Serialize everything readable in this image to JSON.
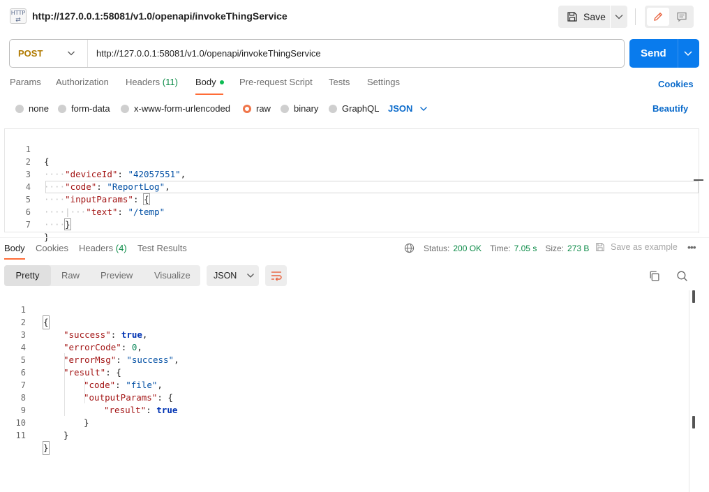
{
  "header": {
    "icon_label": "HTTP",
    "title": "http://127.0.0.1:58081/v1.0/openapi/invokeThingService",
    "save_label": "Save"
  },
  "request": {
    "method": "POST",
    "url": "http://127.0.0.1:58081/v1.0/openapi/invokeThingService",
    "send_label": "Send",
    "tabs": [
      {
        "label": "Params"
      },
      {
        "label": "Authorization"
      },
      {
        "label": "Headers",
        "count": "(11)"
      },
      {
        "label": "Body"
      },
      {
        "label": "Pre-request Script"
      },
      {
        "label": "Tests"
      },
      {
        "label": "Settings"
      }
    ],
    "active_tab": "Body",
    "cookies_label": "Cookies",
    "body_types": [
      "none",
      "form-data",
      "x-www-form-urlencoded",
      "raw",
      "binary",
      "GraphQL"
    ],
    "selected_body_type": "raw",
    "language": "JSON",
    "beautify_label": "Beautify",
    "line_numbers": [
      "1",
      "2",
      "3",
      "4",
      "5",
      "6",
      "7"
    ],
    "body_lines": [
      "{",
      "\"deviceId\": \"42057551\",",
      "\"code\": \"ReportLog\",",
      "\"inputParams\": {",
      "\"text\": \"/temp\"",
      "}",
      "}"
    ]
  },
  "response": {
    "tabs": [
      {
        "label": "Body"
      },
      {
        "label": "Cookies"
      },
      {
        "label": "Headers",
        "count": "(4)"
      },
      {
        "label": "Test Results"
      }
    ],
    "status_label": "Status:",
    "status_value": "200 OK",
    "time_label": "Time:",
    "time_value": "7.05 s",
    "size_label": "Size:",
    "size_value": "273 B",
    "save_example_label": "Save as example",
    "views": [
      "Pretty",
      "Raw",
      "Preview",
      "Visualize"
    ],
    "active_view": "Pretty",
    "format": "JSON",
    "line_numbers": [
      "1",
      "2",
      "3",
      "4",
      "5",
      "6",
      "7",
      "8",
      "9",
      "10",
      "11"
    ],
    "body_lines": [
      "{",
      "\"success\": true,",
      "\"errorCode\": 0,",
      "\"errorMsg\": \"success\",",
      "\"result\": {",
      "\"code\": \"file\",",
      "\"outputParams\": {",
      "\"result\": true",
      "}",
      "}",
      "}"
    ]
  },
  "colors": {
    "accent_orange": "#ff6c37",
    "send_blue": "#097bed",
    "link_blue": "#0b6bcb",
    "method_post": "#b07a00",
    "status_green": "#0a8a46"
  }
}
